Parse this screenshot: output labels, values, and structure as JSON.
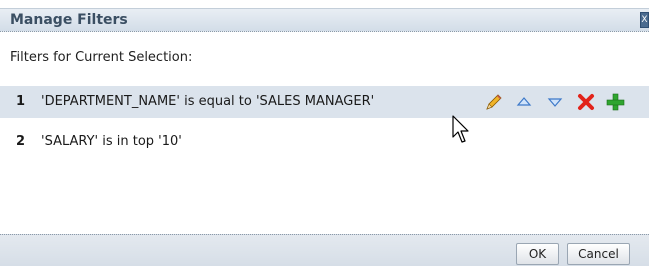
{
  "dialog": {
    "title": "Manage Filters",
    "close_glyph": "X"
  },
  "subtitle": "Filters for Current Selection:",
  "filters": [
    {
      "number": "1",
      "text": "'DEPARTMENT_NAME' is equal to 'SALES MANAGER'",
      "selected": true
    },
    {
      "number": "2",
      "text": "'SALARY' is in top '10'",
      "selected": false
    }
  ],
  "row_actions": {
    "edit_icon": "pencil-icon",
    "move_up_icon": "triangle-up-icon",
    "move_down_icon": "triangle-down-icon",
    "delete_icon": "red-x-icon",
    "add_icon": "green-plus-icon"
  },
  "buttons": {
    "ok_label": "OK",
    "cancel_label": "Cancel"
  },
  "colors": {
    "header_title": "#3b4f63",
    "selected_row": "#dbe3ec",
    "delete": "#e2231a",
    "add": "#2fa52f",
    "arrows": "#3c78c8",
    "pencil": "#e0a400"
  }
}
